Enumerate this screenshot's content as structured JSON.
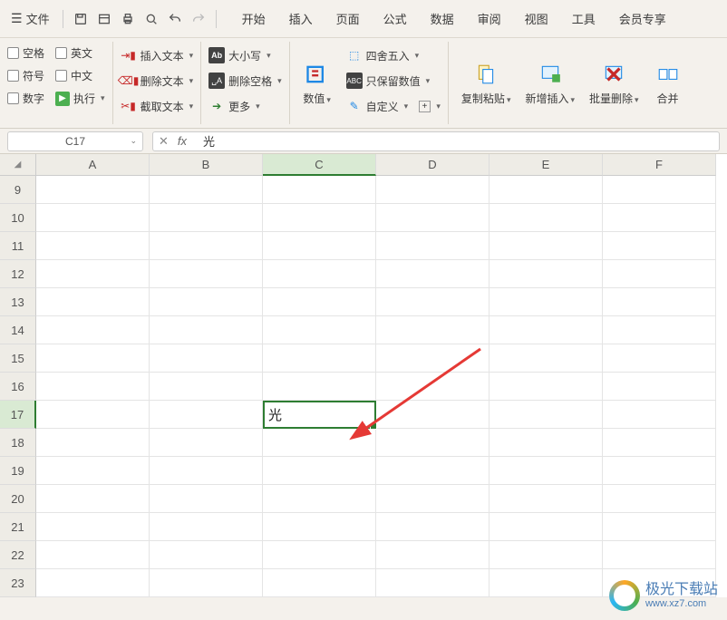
{
  "topbar": {
    "file_label": "文件",
    "tabs": [
      "开始",
      "插入",
      "页面",
      "公式",
      "数据",
      "审阅",
      "视图",
      "工具",
      "会员专享"
    ]
  },
  "ribbon": {
    "checks": {
      "space": "空格",
      "english": "英文",
      "symbol": "符号",
      "chinese": "中文",
      "number": "数字",
      "exec": "执行"
    },
    "group2": {
      "insert_text": "插入文本",
      "delete_text": "删除文本",
      "extract_text": "截取文本"
    },
    "group3": {
      "case": "大小写",
      "delete_space": "删除空格",
      "more": "更多"
    },
    "group4": {
      "value": "数值",
      "round": "四舍五入",
      "keep_num": "只保留数值",
      "custom": "自定义"
    },
    "group5": {
      "copy_paste": "复制粘贴",
      "new_insert": "新增插入",
      "batch_delete": "批量删除",
      "merge": "合并"
    }
  },
  "namebox": "C17",
  "fx_value": "光",
  "columns": [
    "A",
    "B",
    "C",
    "D",
    "E",
    "F"
  ],
  "rows": [
    "9",
    "10",
    "11",
    "12",
    "13",
    "14",
    "15",
    "16",
    "17",
    "18",
    "19",
    "20",
    "21",
    "22",
    "23"
  ],
  "selected_col": "C",
  "selected_row": "17",
  "cell_value": "光",
  "watermark": {
    "name": "极光下载站",
    "url": "www.xz7.com"
  }
}
